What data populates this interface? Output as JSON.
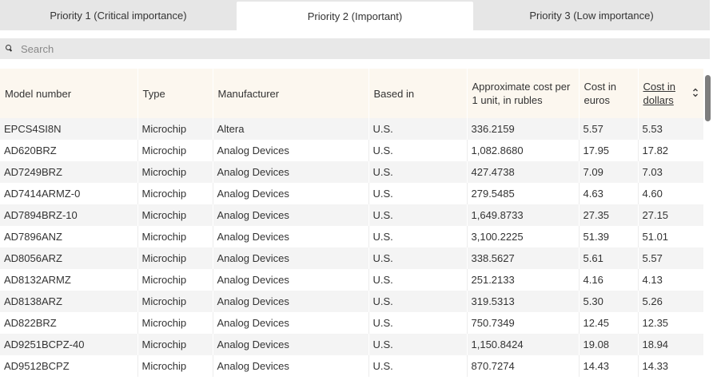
{
  "tabs": [
    {
      "label": "Priority 1 (Critical importance)",
      "active": false
    },
    {
      "label": "Priority 2 (Important)",
      "active": true
    },
    {
      "label": "Priority 3 (Low importance)",
      "active": false
    }
  ],
  "search": {
    "placeholder": "Search",
    "value": ""
  },
  "table": {
    "headers": [
      "Model number",
      "Type",
      "Manufacturer",
      "Based in",
      "Approximate cost per 1 unit, in rubles",
      "Cost in euros",
      "Cost in dollars"
    ],
    "sorted_column": "Cost in dollars",
    "rows": [
      [
        "EPCS4SI8N",
        "Microchip",
        "Altera",
        "U.S.",
        "336.2159",
        "5.57",
        "5.53"
      ],
      [
        "AD620BRZ",
        "Microchip",
        "Analog Devices",
        "U.S.",
        "1,082.8680",
        "17.95",
        "17.82"
      ],
      [
        "AD7249BRZ",
        "Microchip",
        "Analog Devices",
        "U.S.",
        "427.4738",
        "7.09",
        "7.03"
      ],
      [
        "AD7414ARMZ-0",
        "Microchip",
        "Analog Devices",
        "U.S.",
        "279.5485",
        "4.63",
        "4.60"
      ],
      [
        "AD7894BRZ-10",
        "Microchip",
        "Analog Devices",
        "U.S.",
        "1,649.8733",
        "27.35",
        "27.15"
      ],
      [
        "AD7896ANZ",
        "Microchip",
        "Analog Devices",
        "U.S.",
        "3,100.2225",
        "51.39",
        "51.01"
      ],
      [
        "AD8056ARZ",
        "Microchip",
        "Analog Devices",
        "U.S.",
        "338.5627",
        "5.61",
        "5.57"
      ],
      [
        "AD8132ARMZ",
        "Microchip",
        "Analog Devices",
        "U.S.",
        "251.2133",
        "4.16",
        "4.13"
      ],
      [
        "AD8138ARZ",
        "Microchip",
        "Analog Devices",
        "U.S.",
        "319.5313",
        "5.30",
        "5.26"
      ],
      [
        "AD822BRZ",
        "Microchip",
        "Analog Devices",
        "U.S.",
        "750.7349",
        "12.45",
        "12.35"
      ],
      [
        "AD9251BCPZ-40",
        "Microchip",
        "Analog Devices",
        "U.S.",
        "1,150.8424",
        "19.08",
        "18.94"
      ],
      [
        "AD9512BCPZ",
        "Microchip",
        "Analog Devices",
        "U.S.",
        "870.7274",
        "14.43",
        "14.33"
      ]
    ]
  }
}
